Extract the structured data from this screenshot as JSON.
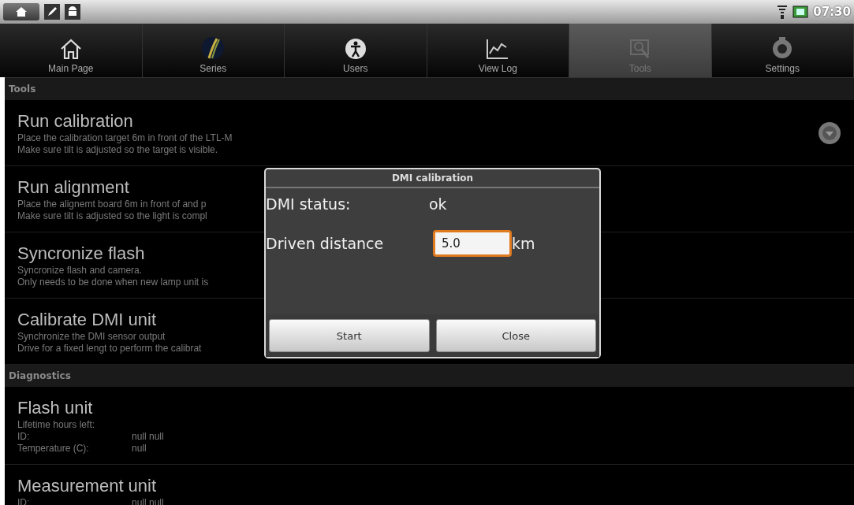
{
  "status_bar": {
    "time": "07:30"
  },
  "tabs": [
    {
      "label": "Main Page",
      "selected": false
    },
    {
      "label": "Series",
      "selected": false
    },
    {
      "label": "Users",
      "selected": false
    },
    {
      "label": "View Log",
      "selected": false
    },
    {
      "label": "Tools",
      "selected": true
    },
    {
      "label": "Settings",
      "selected": false
    }
  ],
  "sections": [
    {
      "title": "Tools",
      "items": [
        {
          "kind": "action",
          "title": "Run calibration",
          "indicator": true,
          "lines": [
            "Place the calibration target 6m in front of the LTL-M",
            "Make sure tilt is adjusted so the target is visible."
          ]
        },
        {
          "kind": "action",
          "title": "Run alignment",
          "indicator": false,
          "lines": [
            "Place the alignemt board 6m in front of and p",
            "Make sure tilt is adjusted so the light is compl"
          ]
        },
        {
          "kind": "action",
          "title": "Syncronize flash",
          "indicator": false,
          "lines": [
            "Syncronize flash and camera.",
            "Only needs to be done when new lamp unit is"
          ]
        },
        {
          "kind": "action",
          "title": "Calibrate DMI unit",
          "indicator": false,
          "lines": [
            "Synchronize the DMI sensor output",
            "Drive for a fixed lengt to perform the calibrat"
          ]
        }
      ]
    },
    {
      "title": "Diagnostics",
      "items": [
        {
          "kind": "info",
          "title": "Flash unit",
          "indicator": false,
          "fields": [
            {
              "label": "Lifetime hours left:"
            },
            {
              "label": "ID:",
              "value": "null null"
            },
            {
              "label": "Temperature (C):",
              "value": "null"
            }
          ]
        },
        {
          "kind": "info",
          "title": "Measurement unit",
          "indicator": false,
          "fields": [
            {
              "label": "ID:",
              "value": "null null"
            }
          ]
        }
      ]
    }
  ],
  "dialog": {
    "title": "DMI calibration",
    "status": {
      "label": "DMI status:",
      "value": "ok"
    },
    "distance": {
      "label": "Driven distance",
      "value": "5.0",
      "unit": "km",
      "focused": true
    },
    "buttons": [
      "Start",
      "Close"
    ]
  }
}
